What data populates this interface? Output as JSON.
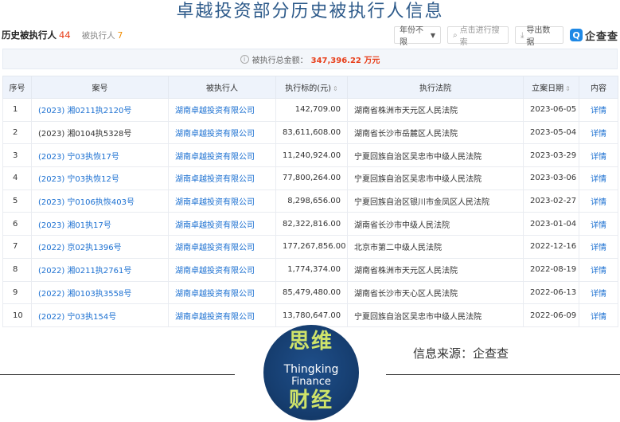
{
  "page_title": "卓越投资部分历史被执行人信息",
  "tabs": {
    "active_label": "历史被执行人",
    "active_count": "44",
    "other_label": "被执行人",
    "other_count": "7"
  },
  "controls": {
    "year_filter": "年份不限",
    "search_placeholder": "点击进行搜索",
    "export_label": "导出数据"
  },
  "brand": {
    "mark": "Q",
    "name": "企查查"
  },
  "summary": {
    "label": "被执行总金额：",
    "amount": "347,396.22 万元"
  },
  "table": {
    "headers": [
      "序号",
      "案号",
      "被执行人",
      "执行标的(元)",
      "执行法院",
      "立案日期",
      "内容"
    ],
    "rows": [
      {
        "no": "1",
        "case": "(2023) 湘0211执2120号",
        "party": "湖南卓越投资有限公司",
        "amount": "142,709.00",
        "court": "湖南省株洲市天元区人民法院",
        "date": "2023-06-05",
        "detail": "详情"
      },
      {
        "no": "2",
        "case": "(2023) 湘0104执5328号",
        "party": "湖南卓越投资有限公司",
        "amount": "83,611,608.00",
        "court": "湖南省长沙市岳麓区人民法院",
        "date": "2023-05-04",
        "detail": "详情"
      },
      {
        "no": "3",
        "case": "(2023) 宁03执恢17号",
        "party": "湖南卓越投资有限公司",
        "amount": "11,240,924.00",
        "court": "宁夏回族自治区吴忠市中级人民法院",
        "date": "2023-03-29",
        "detail": "详情"
      },
      {
        "no": "4",
        "case": "(2023) 宁03执恢12号",
        "party": "湖南卓越投资有限公司",
        "amount": "77,800,264.00",
        "court": "宁夏回族自治区吴忠市中级人民法院",
        "date": "2023-03-06",
        "detail": "详情"
      },
      {
        "no": "5",
        "case": "(2023) 宁0106执恢403号",
        "party": "湖南卓越投资有限公司",
        "amount": "8,298,656.00",
        "court": "宁夏回族自治区银川市金凤区人民法院",
        "date": "2023-02-27",
        "detail": "详情"
      },
      {
        "no": "6",
        "case": "(2023) 湘01执17号",
        "party": "湖南卓越投资有限公司",
        "amount": "82,322,816.00",
        "court": "湖南省长沙市中级人民法院",
        "date": "2023-01-04",
        "detail": "详情"
      },
      {
        "no": "7",
        "case": "(2022) 京02执1396号",
        "party": "湖南卓越投资有限公司",
        "amount": "177,267,856.00",
        "court": "北京市第二中级人民法院",
        "date": "2022-12-16",
        "detail": "详情"
      },
      {
        "no": "8",
        "case": "(2022) 湘0211执2761号",
        "party": "湖南卓越投资有限公司",
        "amount": "1,774,374.00",
        "court": "湖南省株洲市天元区人民法院",
        "date": "2022-08-19",
        "detail": "详情"
      },
      {
        "no": "9",
        "case": "(2022) 湘0103执3558号",
        "party": "湖南卓越投资有限公司",
        "amount": "85,479,480.00",
        "court": "湖南省长沙市天心区人民法院",
        "date": "2022-06-13",
        "detail": "详情"
      },
      {
        "no": "10",
        "case": "(2022) 宁03执154号",
        "party": "湖南卓越投资有限公司",
        "amount": "13,780,647.00",
        "court": "宁夏回族自治区吴忠市中级人民法院",
        "date": "2022-06-09",
        "detail": "详情"
      }
    ]
  },
  "footer": {
    "source": "信息来源：企查查",
    "logo_top": "思维",
    "logo_en1": "Thingking",
    "logo_en2": "Finance",
    "logo_bottom": "财经"
  },
  "colors": {
    "link": "#1a6fd1",
    "accent_red": "#e8401c",
    "title_blue": "#2d5a8a",
    "header_bg": "#eef3fb"
  }
}
